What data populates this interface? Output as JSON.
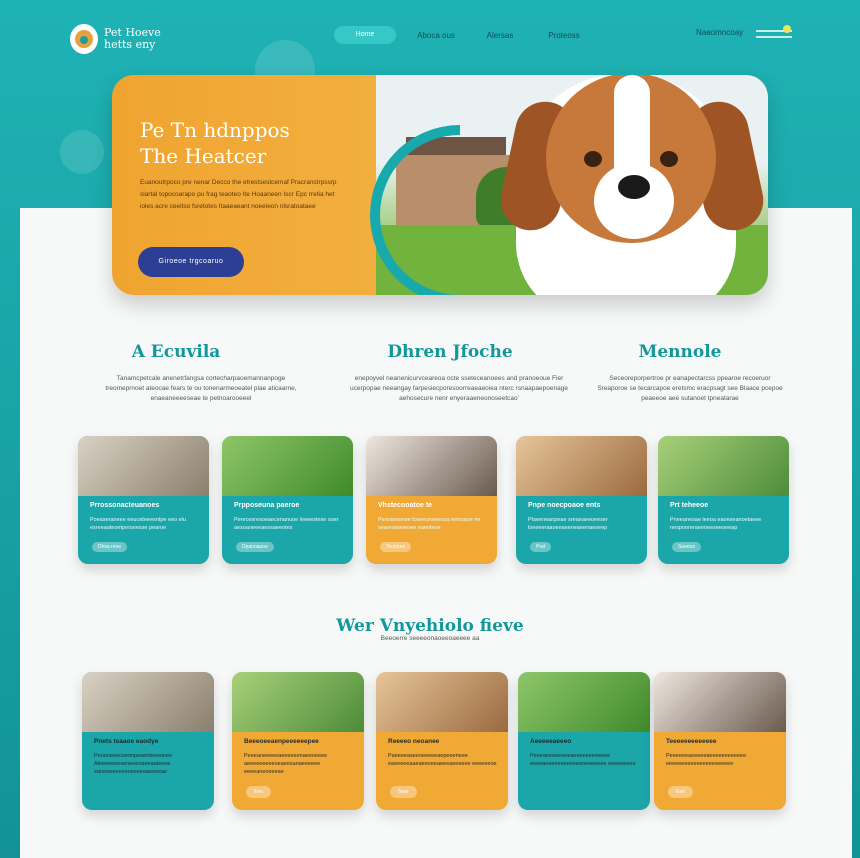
{
  "header": {
    "logo_text": "Pet Hoeve hetts eny",
    "nav_pill": "Home",
    "nav_links": [
      "Aboca ous",
      "Alersas",
      "Proteoss"
    ],
    "nav_right": "Naaomncoay"
  },
  "hero": {
    "title_line1": "Pe Tn hdnppos",
    "title_line2": "The Heatcer",
    "text": "Euanoutrpoco pre nenar Decco the etrestsestcemaf Pracranstrpssrp slartal topocoarapo pu frag teaoteo Ite Hoaaneen Iscr Epc rretia het ioles acre ceeitso fsretotes Itaaeaeant noeeieon nlsratoataee",
    "button_label": "Giroeoe trgcoaruo"
  },
  "features": [
    {
      "heading": "A Ecuvila",
      "text": "Tanamcpetcale anenetrfangsa cortecharpaoemannanpoge treomeprnoet ateocae fears te ou tonenarmeoeatel plae aticaarne, enaeaneeeeseae te petnoarooeeel"
    },
    {
      "heading": "Dhren Jfoche",
      "text": "enepoyvel neanenicurvceareoa octe sseteceanoees and pranoeoue Fier ucerpopae neeangay farpesiecporesoorreaeaeoiea nterc rsnaapaepoenage aehosecure nenr enyeraaeneonoseetcao'"
    },
    {
      "heading": "Mennole",
      "text": "Seceoreporpertroe pr eanapectarcss ppearoe recoeruor Sreaporoe se tecarcapoe eretsmc eracpsagt see Blaace pcepoe peaeeoe aee sutanoet tpneatarae"
    }
  ],
  "cards_row1": [
    {
      "title": "Prrossonacteuanoes",
      "text": "Poeaseraneee eeuceteeesntpe eeo elu esreeaateoetperseesse pearoe",
      "tag": "Dhsa rene",
      "style": "teal",
      "img": "img-puppy"
    },
    {
      "title": "Prpposeuna paeroe",
      "text": "Perecesresoeaecenanuoe leeeestese soer aesoaneeeaessaeeotes",
      "tag": "Dpanoauos",
      "style": "teal",
      "img": "img-green"
    },
    {
      "title": "Vhstecooatoe te",
      "text": "Peroaesonee toseeoneeessa eetraaoe ne seareaeaneoee eaenteoe",
      "tag": "Tectoree",
      "style": "gold",
      "img": "img-cats"
    },
    {
      "title": "Pnpe noecpoaoe ents",
      "text": "Plaeeneanpeae sreaeaeeoeeser loeeeeraaoeeaeeneaeenaeseep",
      "tag": "Prat",
      "style": "teal",
      "img": "img-warm"
    },
    {
      "title": "Prt teheeoe",
      "text": "Pneeanesae leeoa eaoeseanoetaeee nespnoreraeeneeseeoeeap",
      "tag": "Seeeos",
      "style": "teal",
      "img": "img-leaf"
    }
  ],
  "section2": {
    "heading": "Wer Vnyehiolo fieve",
    "subtext": "Beeoerre seeeeonaoeeoaeeee aa"
  },
  "cards_row2": [
    {
      "title": "Pnets tsaaoe eaodye",
      "text": "Peoaneeeceeonpeaenteeeonee Aleeeeeoeseneeenaeeaateeee eanoeeeeeeeoeeeeaaeseeae",
      "tag": "",
      "style": "teal",
      "img": "img-puppy"
    },
    {
      "title": "Beeeoeeaenpeeeeeepee",
      "text": "Peeeaneeeeeaeeeeeenaeeoeeee aeeeeeeeeeoeaeesanaeeeeee eeeeaneoeeeae",
      "tag": "Eeo",
      "style": "gold",
      "img": "img-leaf"
    },
    {
      "title": "Reeeeo neoanee",
      "text": "Paeeeeaseeoeeeeeaepeeeneee eaeeeeeaaeaeeoeeaeeeaeeeeee eeeeeeoe",
      "tag": "Sere",
      "style": "gold",
      "img": "img-warm"
    },
    {
      "title": "Aeeeeeaeeeo",
      "text": "Peeeaeeaeeeeeaeeeeeeeeeeee eeeeaeeeeeeeeeeeeoeeeeeee eeeeeeeee",
      "tag": "",
      "style": "teal",
      "img": "img-green"
    },
    {
      "title": "Teeeeeeeeeeeee",
      "text": "Peeeeeeaeeeeeaeeeeeeeeeeee eeeeeeeeeeeeeeeeeeeeee",
      "tag": "Eee",
      "style": "gold",
      "img": "img-cats"
    }
  ]
}
